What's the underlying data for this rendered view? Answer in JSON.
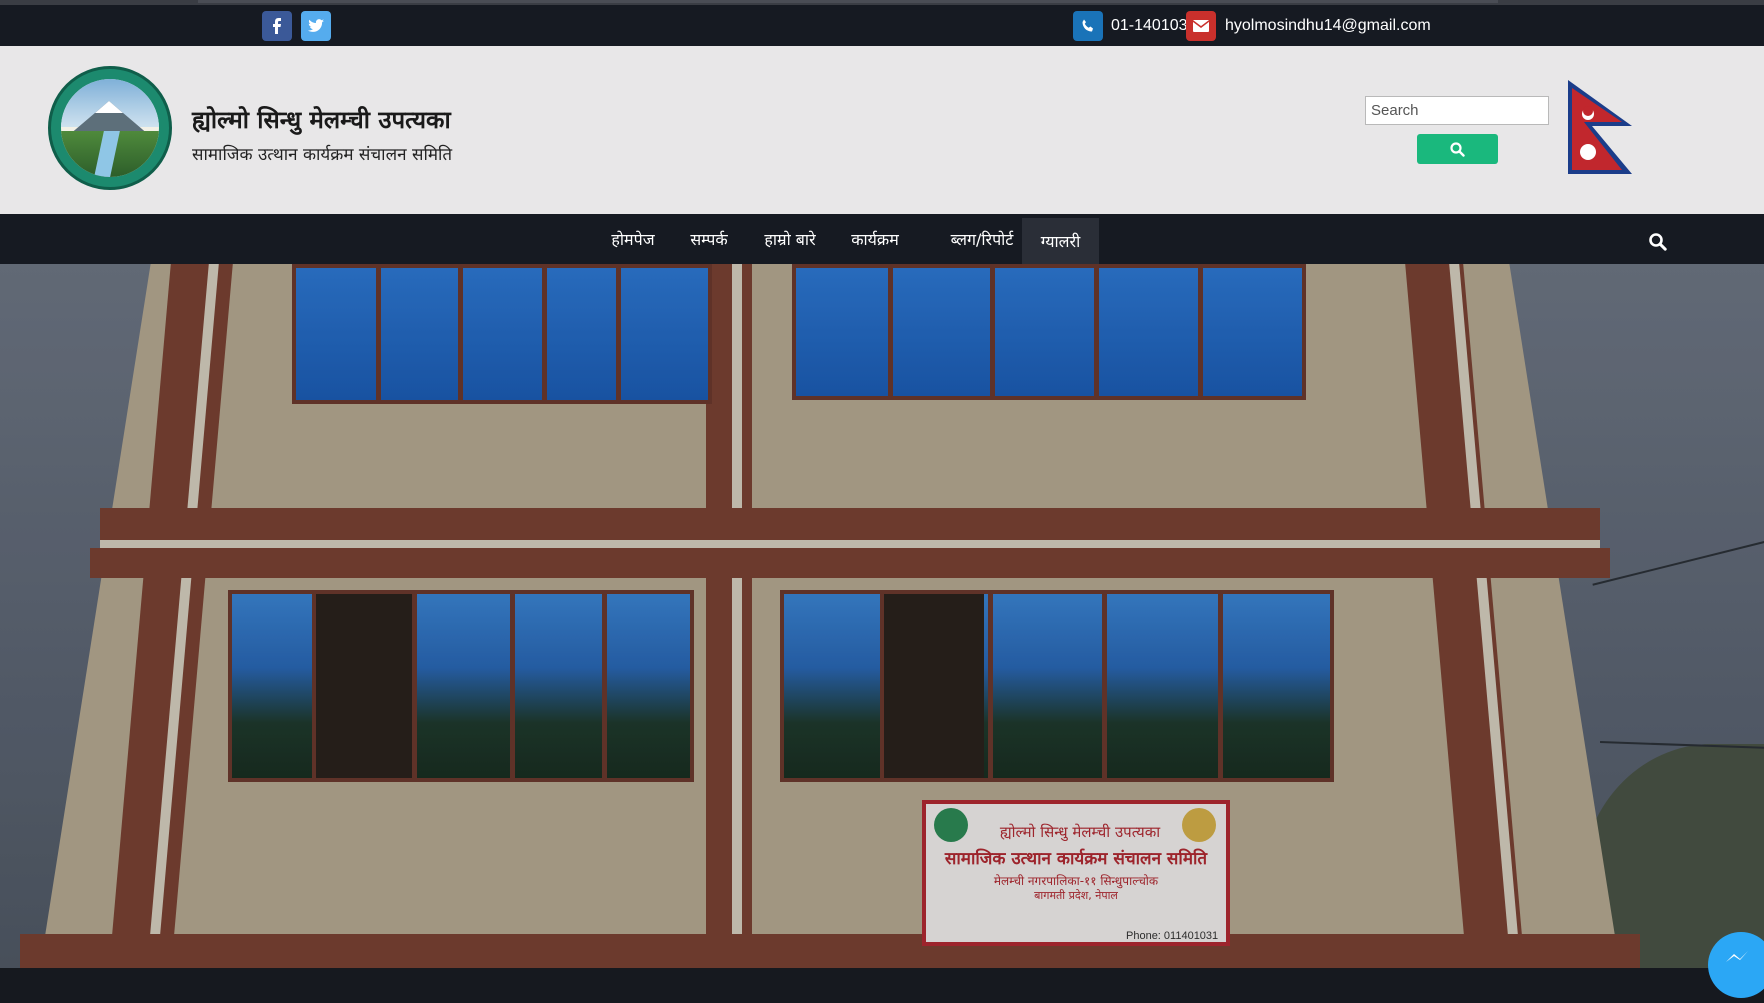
{
  "topbar": {
    "social": [
      {
        "name": "facebook",
        "icon": "facebook-icon"
      },
      {
        "name": "twitter",
        "icon": "twitter-icon"
      }
    ],
    "phone": "01-1401031",
    "email": "hyolmosindhu14@gmail.com"
  },
  "header": {
    "title": "ह्योल्मो सिन्धु मेलम्ची उपत्यका",
    "subtitle": "सामाजिक उत्थान कार्यक्रम संचालन समिति",
    "search_placeholder": "Search"
  },
  "nav": {
    "items": [
      {
        "label": "होमपेज",
        "active": false
      },
      {
        "label": "सम्पर्क",
        "active": false
      },
      {
        "label": "हाम्रो बारे",
        "active": false
      },
      {
        "label": "कार्यक्रम",
        "active": false
      },
      {
        "label": "ब्लग/रिपोर्ट",
        "active": false
      },
      {
        "label": "ग्यालरी",
        "active": true
      }
    ]
  },
  "hero": {
    "sign_line1": "ह्योल्मो सिन्धु मेलम्ची उपत्यका",
    "sign_line2": "सामाजिक उत्थान कार्यक्रम संचालन समिति",
    "sign_line3": "मेलम्ची नगरपालिका-११ सिन्धुपाल्चोक",
    "sign_line4": "बागमती प्रदेश, नेपाल",
    "sign_phone": "Phone: 011401031"
  },
  "colors": {
    "topbar_bg": "#161a22",
    "header_bg": "#e8e7e8",
    "search_button": "#1ab87d",
    "facebook": "#3b5998",
    "twitter": "#55acee",
    "phone_icon": "#1a73b8",
    "mail_icon": "#c9302c"
  }
}
